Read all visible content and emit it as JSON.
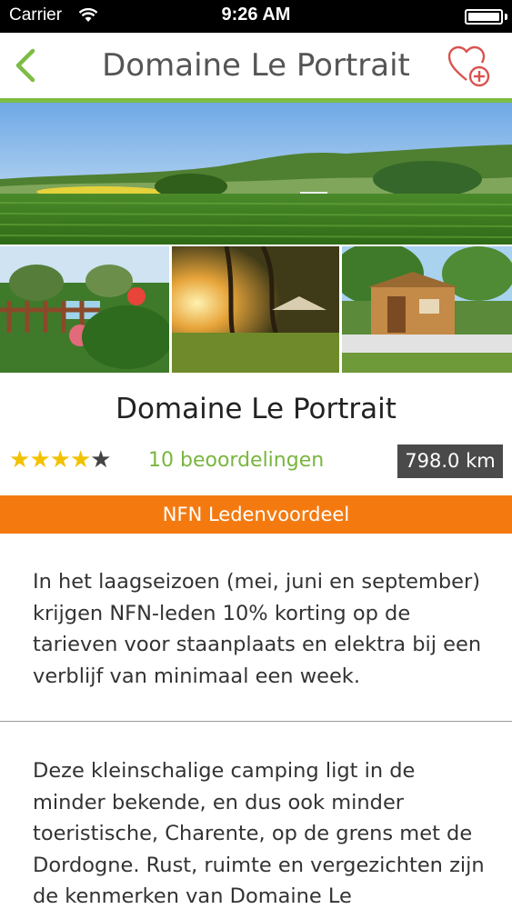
{
  "status_bar": {
    "carrier": "Carrier",
    "time": "9:26 AM",
    "battery_level": 1.0
  },
  "nav": {
    "title": "Domaine Le Portrait",
    "back_icon": "chevron-left-icon",
    "favorite_icon": "heart-plus-icon",
    "accent_color": "#7dbc45",
    "favorite_color": "#d9534f"
  },
  "place": {
    "name": "Domaine Le Portrait",
    "rating": 4,
    "rating_max": 5,
    "reviews_label": "10 beoordelingen",
    "distance": "798.0 km"
  },
  "member_banner": {
    "label": "NFN Ledenvoordeel",
    "color": "#f47a10"
  },
  "content": {
    "member_text": "In het laagseizoen (mei, juni en september) krijgen NFN-leden 10% korting op de tarieven voor staanplaats en elektra bij een verblijf van minimaal een week.",
    "description": "Deze kleinschalige camping ligt in de minder bekende, en dus ook minder toeristische, Charente, op de grens met de Dordogne. Rust, ruimte en vergezichten zijn de kenmerken van Domaine Le"
  }
}
